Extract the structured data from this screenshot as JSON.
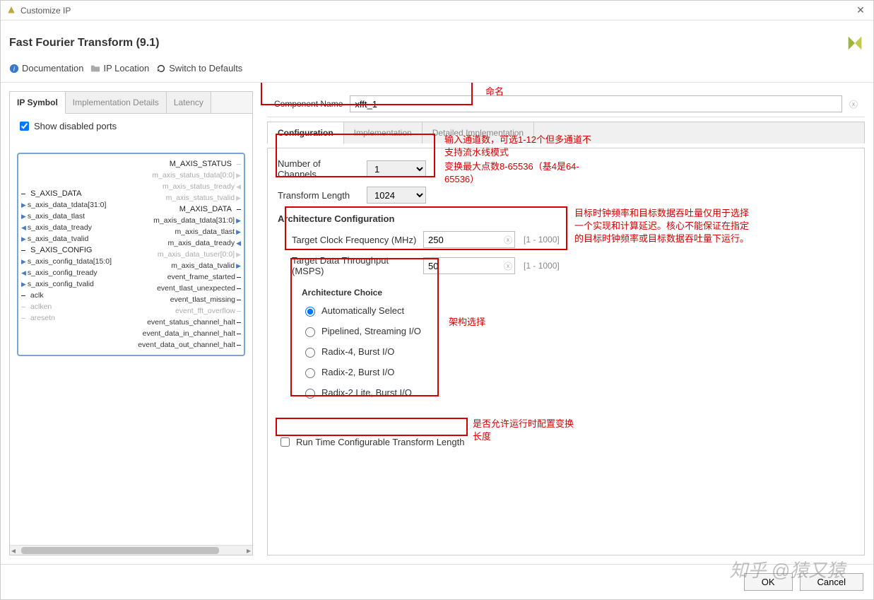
{
  "window": {
    "title": "Customize IP"
  },
  "header": {
    "title": "Fast Fourier Transform (9.1)"
  },
  "toolbar": {
    "doc": "Documentation",
    "loc": "IP Location",
    "reset": "Switch to Defaults"
  },
  "leftTabs": {
    "t1": "IP Symbol",
    "t2": "Implementation Details",
    "t3": "Latency"
  },
  "leftPanel": {
    "showDisabled": "Show disabled ports"
  },
  "ipPorts": {
    "leftHeader1": "S_AXIS_DATA",
    "l1": "s_axis_data_tdata[31:0]",
    "l2": "s_axis_data_tlast",
    "l3": "s_axis_data_tready",
    "l4": "s_axis_data_tvalid",
    "leftHeader2": "S_AXIS_CONFIG",
    "l5": "s_axis_config_tdata[15:0]",
    "l6": "s_axis_config_tready",
    "l7": "s_axis_config_tvalid",
    "l8": "aclk",
    "l9": "aclken",
    "l10": "aresetn",
    "rightHeader1": "M_AXIS_STATUS",
    "r1": "m_axis_status_tdata[0:0]",
    "r2": "m_axis_status_tready",
    "r3": "m_axis_status_tvalid",
    "rightHeader2": "M_AXIS_DATA",
    "r4": "m_axis_data_tdata[31:0]",
    "r5": "m_axis_data_tlast",
    "r6": "m_axis_data_tready",
    "r7": "m_axis_data_tuser[0:0]",
    "r8": "m_axis_data_tvalid",
    "r9": "event_frame_started",
    "r10": "event_tlast_unexpected",
    "r11": "event_tlast_missing",
    "r12": "event_fft_overflow",
    "r13": "event_status_channel_halt",
    "r14": "event_data_in_channel_halt",
    "r15": "event_data_out_channel_halt"
  },
  "component": {
    "label": "Component Name",
    "value": "xfft_1"
  },
  "cfgTabs": {
    "t1": "Configuration",
    "t2": "Implementation",
    "t3": "Detailed Implementation"
  },
  "cfg": {
    "numChannelsLabel": "Number of Channels",
    "numChannels": "1",
    "transformLenLabel": "Transform Length",
    "transformLen": "1024",
    "archCfgTitle": "Architecture Configuration",
    "clockLabel": "Target Clock Frequency (MHz)",
    "clockVal": "250",
    "clockRange": "[1 - 1000]",
    "throughputLabel": "Target Data Throughput (MSPS)",
    "throughputVal": "50",
    "throughputRange": "[1 - 1000]",
    "archChoiceTitle": "Architecture Choice",
    "archOpt1": "Automatically Select",
    "archOpt2": "Pipelined, Streaming I/O",
    "archOpt3": "Radix-4, Burst I/O",
    "archOpt4": "Radix-2, Burst I/O",
    "archOpt5": "Radix-2 Lite, Burst I/O",
    "runtimeCheck": "Run Time Configurable Transform Length"
  },
  "anno": {
    "a1": "命名",
    "a2": "输入通道数，可选1-12个但多通道不支持流水线模式",
    "a3": "变换最大点数8-65536（基4是64-65536）",
    "a4": "目标时钟频率和目标数据吞吐量仅用于选择一个实现和计算延迟。核心不能保证在指定的目标时钟频率或目标数据吞吐量下运行。",
    "a5": "架构选择",
    "a6": "是否允许运行时配置变换长度"
  },
  "footer": {
    "ok": "OK",
    "cancel": "Cancel"
  },
  "watermark": "知乎 @猿又猿"
}
